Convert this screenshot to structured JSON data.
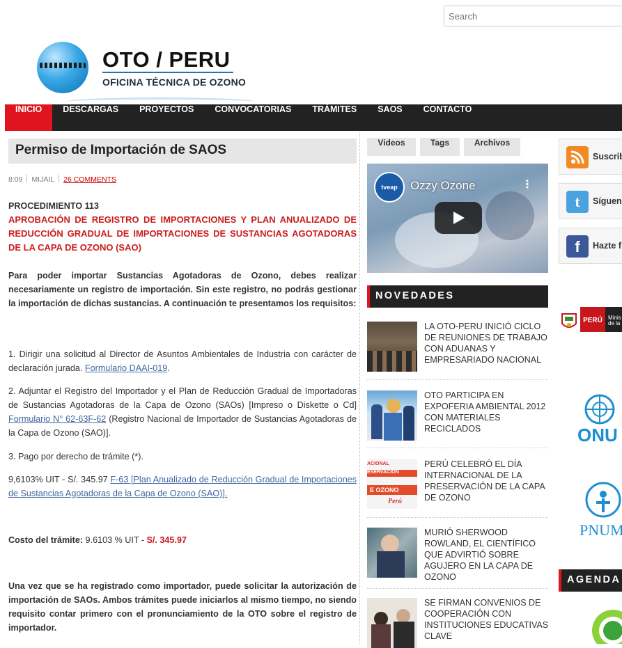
{
  "search": {
    "placeholder": "Search"
  },
  "logo": {
    "title": "OTO / PERU",
    "subtitle": "OFICINA TÉCNICA DE OZONO"
  },
  "nav": [
    "INICIO",
    "DESCARGAS",
    "PROYECTOS",
    "CONVOCATORIAS",
    "TRÁMITES",
    "SAOS",
    "CONTACTO"
  ],
  "nav_active": "INICIO",
  "post": {
    "title": "Permiso de Importación de SAOS",
    "time": "8:09",
    "author": "MIJAIL",
    "comments": "26 COMMENTS",
    "procedure": "PROCEDIMIENTO 113",
    "heading": "APROBACIÓN DE REGISTRO DE IMPORTACIONES Y PLAN ANUALIZADO DE REDUCCIÓN GRADUAL DE IMPORTACIONES DE SUSTANCIAS AGOTADORAS DE LA CAPA DE OZONO (SAO)",
    "intro": "Para poder importar Sustancias Agotadoras de Ozono, debes realizar necesariamente un registro de importación. Sin este registro, no podrás gestionar la importación de dichas sustancias. A continuación te presentamos los requisitos:",
    "req1_text": "1. Dirigir una solicitud al Director de Asuntos Ambientales de Industria con carácter de declaración jurada. ",
    "req1_link": "Formulario DAAI-019",
    "req1_end": ".",
    "req2_text": "2. Adjuntar el Registro del Importador y el Plan de Reducción Gradual de Importadoras de Sustancias Agotadoras de la Capa de Ozono (SAOs) [Impreso o Diskette o Cd] ",
    "req2_link": "Formulario N° 62-63F-62",
    "req2_end": " (Registro Nacional de Importador de Sustancias Agotadoras de la Capa de Ozono (SAO)].",
    "req3": "3. Pago por derecho de trámite (*).",
    "fee_text": "9,6103% UIT - S/. 345.97 ",
    "fee_link": "F-63 [Plan Anualizado de Reducción Gradual de Importaciones de Sustancias Agotadoras de la Capa de Ozono (SAO)].",
    "cost_label": "Costo del trámite:",
    "cost_value": " 9.6103 % UIT - ",
    "cost_amount": "S/. 345.97",
    "closing": "Una vez que se ha registrado como importador, puede solicitar la autorización de importación de SAOs. Ambos trámites puede iniciarlos al mismo tiempo, no siendo requisito contar primero con el pronunciamiento de la OTO sobre el registro de importador."
  },
  "tabs": [
    "Videos",
    "Tags",
    "Archivos"
  ],
  "video": {
    "title": "Ozzy Ozone",
    "channel": "tveap"
  },
  "novedades": {
    "heading": "NOVEDADES",
    "items": [
      "LA OTO-PERU INICIÓ CICLO DE REUNIONES DE TRABAJO CON ADUANAS Y EMPRESARIADO NACIONAL",
      "OTO PARTICIPA EN EXPOFERIA AMBIENTAL 2012 CON MATERIALES RECICLADOS",
      "PERÚ CELEBRÓ EL DÍA INTERNACIONAL DE LA PRESERVACIÓN DE LA CAPA DE OZONO",
      "MURIÓ SHERWOOD ROWLAND, EL CIENTÍFICO QUE ADVIRTIÓ SOBRE AGUJERO EN LA CAPA DE OZONO",
      "SE FIRMAN CONVENIOS DE COOPERACIÓN CON INSTITUCIONES EDUCATIVAS CLAVE"
    ],
    "thumb3_lines": [
      "ACIONAL",
      "ESERVACIÓN",
      "E OZONO",
      "Perú"
    ]
  },
  "social": [
    "Suscrib",
    "Síguen",
    "Hazte f"
  ],
  "partners": {
    "peru": "PERÚ",
    "ministry": "Minis de la",
    "onu": "ONU",
    "pnuma": "PNUM"
  },
  "agenda": "AGENDA"
}
